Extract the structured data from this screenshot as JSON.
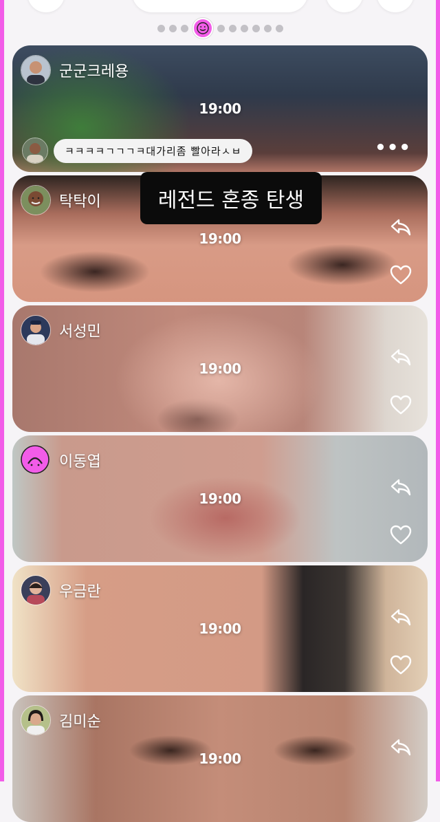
{
  "pager": {
    "dots_before": 3,
    "dots_after": 6
  },
  "caption": "레전드 혼종 탄생",
  "cards": [
    {
      "user": "군군크레용",
      "time": "19:00",
      "comment": {
        "text": "ㅋㅋㅋㅋㄱㄱㄱㅋ대가리좀 빨아라ㅅㅂ"
      }
    },
    {
      "user": "탁탁이",
      "time": "19:00"
    },
    {
      "user": "서성민",
      "time": "19:00"
    },
    {
      "user": "이동엽",
      "time": "19:00"
    },
    {
      "user": "우금란",
      "time": "19:00"
    },
    {
      "user": "김미순",
      "time": "19:00"
    }
  ],
  "colors": {
    "accent": "#f25ce8",
    "background": "#f6f4f7"
  },
  "icons": {
    "reply": "reply-icon",
    "like": "heart-icon",
    "more": "more-icon"
  }
}
